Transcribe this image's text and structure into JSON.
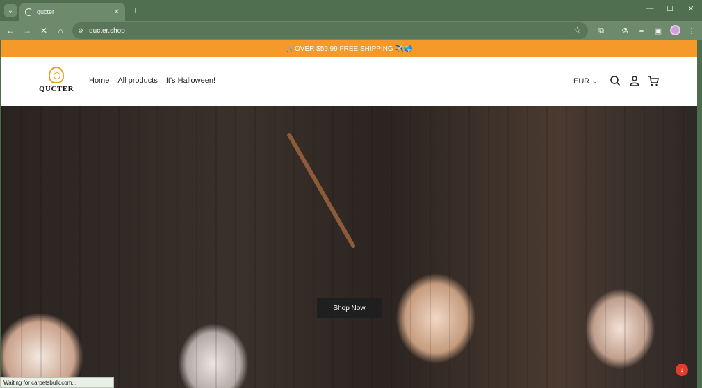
{
  "browser": {
    "tab_title": "qucter",
    "url": "qucter.shop",
    "status_text": "Waiting for carpetsbulk.com..."
  },
  "announcement": {
    "text": "🛒OVER $59.99 FREE SHIPPING ✈️🌎"
  },
  "header": {
    "logo_text": "QUCTER",
    "nav": [
      "Home",
      "All products",
      "It's Halloween!"
    ],
    "currency": "EUR"
  },
  "hero": {
    "cta_label": "Shop Now"
  },
  "colors": {
    "announcement_bg": "#f59a2a",
    "browser_frame": "#4f6f50",
    "cta_bg": "#1f1f1f"
  }
}
